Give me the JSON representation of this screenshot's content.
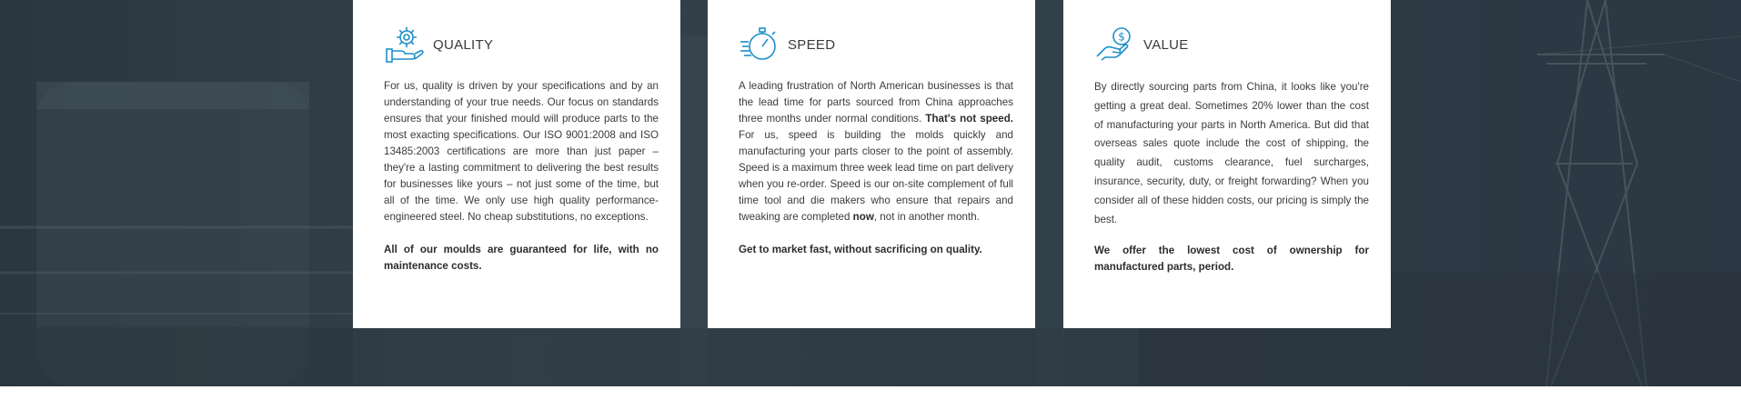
{
  "colors": {
    "accent": "#1e8fc9",
    "card_bg": "#ffffff",
    "text": "#3b3b3b",
    "background": "#2e3a44"
  },
  "cards": [
    {
      "icon": "quality-gear-hand-icon",
      "title": "QUALITY",
      "body_1": "For us, quality is driven by your specifications and by an understanding of your true needs. Our focus on standards ensures that your finished mould will produce parts to the most exacting specifications. Our ISO 9001:2008 and ISO 13485:2003 certifications are more than just paper – they're a lasting commitment to delivering the best results for businesses like yours – not just some of the time, but all of the time. We only use high quality performance-engineered steel. No cheap substitutions, no exceptions.",
      "body_2": "All of our moulds are guaranteed for life, with no maintenance costs."
    },
    {
      "icon": "speed-stopwatch-icon",
      "title": "SPEED",
      "body_1_a": "A leading frustration of North American businesses is that the lead time for parts sourced from China approaches three months under normal conditions. ",
      "body_1_b": "That's not speed.",
      "body_1_c": " For us, speed is building the molds quickly and manufacturing your parts closer to the point of assembly. Speed is a maximum three week lead time on part delivery when you re-order. Speed is our on-site complement of full time tool and die makers who ensure that repairs and tweaking are completed ",
      "body_1_d": "now",
      "body_1_e": ", not in another month.",
      "body_2": "Get to market fast, without sacrificing on quality."
    },
    {
      "icon": "value-hand-coin-icon",
      "title": "VALUE",
      "body_1": "By directly sourcing parts from China, it looks like you're getting a great deal. Sometimes 20% lower than the cost of manufacturing your parts in North America. But did that overseas sales quote include the cost of shipping, the quality audit, customs clearance, fuel surcharges, insurance, security, duty, or freight forwarding? When you consider all of these hidden costs, our pricing is simply the best.",
      "body_2": "We offer the lowest cost of ownership for manufactured parts, period."
    }
  ]
}
